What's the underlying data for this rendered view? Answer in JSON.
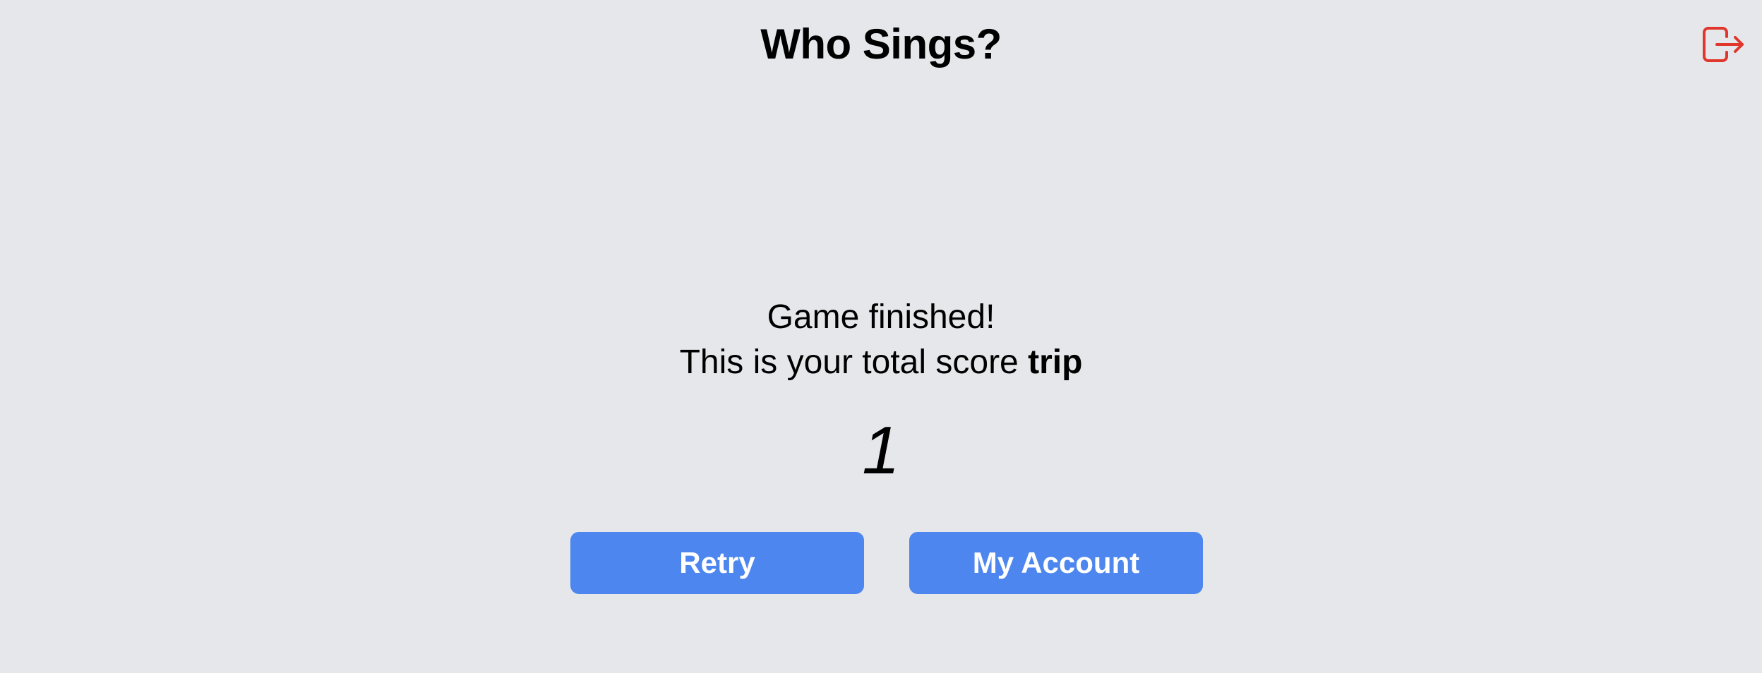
{
  "header": {
    "title": "Who Sings?",
    "logout_icon": "logout-icon",
    "logout_color": "#e0362b"
  },
  "result": {
    "finished_text": "Game finished!",
    "score_prefix": "This is your total score",
    "username": "trip",
    "score": "1"
  },
  "actions": {
    "retry_label": "Retry",
    "account_label": "My Account",
    "button_color": "#4c86ee"
  }
}
